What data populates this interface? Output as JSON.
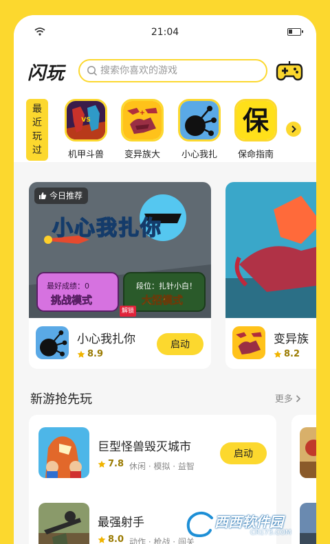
{
  "status": {
    "time": "21:04"
  },
  "header": {
    "logo": "闪玩",
    "search_placeholder": "搜索你喜欢的游戏"
  },
  "recent": {
    "tab_label": [
      "最",
      "近",
      "玩",
      "过"
    ],
    "games": [
      {
        "name": "机甲斗兽"
      },
      {
        "name": "变异族大"
      },
      {
        "name": "小心我扎"
      },
      {
        "name": "保命指南"
      }
    ]
  },
  "featured": [
    {
      "tag": "今日推荐",
      "art_title": "小心我扎你",
      "art_badge_left_top": "最好成绩：0",
      "art_badge_left_bottom": "挑战模式",
      "art_badge_right_top": "段位：扎针小白！",
      "art_badge_right_bottom": "大招模式",
      "art_unlock": "解锁",
      "name": "小心我扎你",
      "rating": "8.9",
      "button": "启动"
    },
    {
      "name": "变异族",
      "rating": "8.2"
    }
  ],
  "new_games": {
    "title": "新游抢先玩",
    "more": "更多",
    "items": [
      {
        "name": "巨型怪兽毁灭城市",
        "rating": "7.8",
        "tags": "休闲 · 模拟 · 益智",
        "button": "启动"
      },
      {
        "name": "最强射手",
        "rating": "8.0",
        "tags": "动作 · 枪战 · 闯关"
      }
    ]
  },
  "watermark": {
    "brand": "西西软件园",
    "url": "CR173.COM"
  },
  "colors": {
    "accent": "#fcd82e",
    "page_bg": "#f6f6f6"
  }
}
